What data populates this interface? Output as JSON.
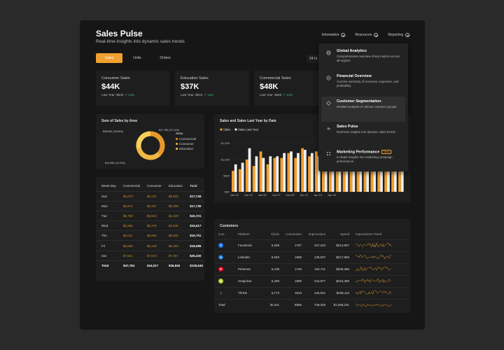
{
  "header": {
    "title": "Sales Pulse",
    "subtitle": "Real-time insights into dynamic sales trends"
  },
  "nav": {
    "items": [
      "Information",
      "Resources",
      "Reporting"
    ]
  },
  "tabs": {
    "items": [
      "Sales",
      "Units",
      "Orders"
    ],
    "active": "Sales"
  },
  "date_filter": "24 hr",
  "kpis": [
    {
      "label": "Consumer Sales",
      "value": "$44K",
      "last_year": "Last Year: $62K",
      "change": "↗ 14%"
    },
    {
      "label": "Education Sales",
      "value": "$37K",
      "last_year": "Last Year: $51K",
      "change": "↗ 14%"
    },
    {
      "label": "Commercial Sales",
      "value": "$48K",
      "last_year": "Last Year: $69K",
      "change": "↗ 14%"
    }
  ],
  "donut_card": {
    "title": "Sum of Sales by Area",
    "labels": [
      "$38.89K (28.84%)",
      "$47.78K (37.14%)",
      "$44.08K (34.22%)"
    ],
    "legend_title": "Area",
    "colors": [
      "#e8982a",
      "#f3b843",
      "#f7cf5a"
    ]
  },
  "weekly_table": {
    "headers": [
      "Week Day",
      "Commercial",
      "Consumer",
      "Education",
      "Total"
    ],
    "rows": [
      [
        "Sun",
        "$6,070",
        "$6,247",
        "$5,533",
        "$17,749"
      ],
      [
        "Mon",
        "$6,574",
        "$6,347",
        "$5,059",
        "$17,730"
      ],
      [
        "Tue",
        "$5,758",
        "$5,624",
        "$4,340",
        "$15,721"
      ],
      [
        "Wed",
        "$6,255",
        "$5,478",
        "$4,845",
        "$16,517"
      ],
      [
        "Thu",
        "$6,011",
        "$5,680",
        "$5,000",
        "$16,701"
      ],
      [
        "Fri",
        "$6,596",
        "$6,129",
        "$5,493",
        "$18,086"
      ],
      [
        "Sat",
        "$7,531",
        "$7,672",
        "$7,067",
        "$25,330"
      ]
    ],
    "total": [
      "Total",
      "$47,784",
      "$44,017",
      "$36,845",
      "$128,646"
    ]
  },
  "customers": {
    "title": "Customers",
    "headers": [
      "Icon",
      "Platform",
      "Clicks",
      "Conversion",
      "Impressions",
      "Spend",
      "Impressions Trend"
    ],
    "rows": [
      {
        "icon": "facebook-icon",
        "color": "#1877f2",
        "glyph": "f",
        "platform": "Facebook",
        "clicks": "6,269",
        "conversion": "1787",
        "impressions": "167,223",
        "spend": "$214,807"
      },
      {
        "icon": "linkedin-icon",
        "color": "#0a66c2",
        "glyph": "in",
        "platform": "LinkedIn",
        "clicks": "5,563",
        "conversion": "1659",
        "impressions": "139,537",
        "spend": "$217,865"
      },
      {
        "icon": "pinterest-icon",
        "color": "#e60023",
        "glyph": "P",
        "platform": "Pinterest",
        "clicks": "6,238",
        "conversion": "1746",
        "impressions": "152,711",
        "spend": "$209,366"
      },
      {
        "icon": "snapchat-icon",
        "color": "#b8d62a",
        "glyph": "S",
        "platform": "Snapchat",
        "clicks": "6,258",
        "conversion": "1850",
        "impressions": "142,877",
        "spend": "$215,355"
      },
      {
        "icon": "tiktok-icon",
        "color": "#222222",
        "glyph": "♪",
        "platform": "TikTok",
        "clicks": "5,773",
        "conversion": "1813",
        "impressions": "146,941",
        "spend": "$208,112"
      }
    ],
    "total": {
      "label": "Total",
      "clicks": "30,411",
      "conversion": "8855",
      "impressions": "749,029",
      "spend": "$1,058,201"
    }
  },
  "dropdown": {
    "items": [
      {
        "title": "Global Analytics",
        "desc": "Comprehensive overview of key metrics across all regions",
        "icon": "globe-icon"
      },
      {
        "title": "Financial Overview",
        "desc": "Concise summary of revenues, expenses, and profitability",
        "icon": "coin-icon"
      },
      {
        "title": "Customer Segmentation",
        "desc": "Detailed analysis of various customer groups",
        "icon": "diamond-icon"
      },
      {
        "title": "Sales Pulse",
        "desc": "Real-time insights into dynamic sales trends",
        "icon": "pulse-icon"
      },
      {
        "title": "Marketing Performance",
        "desc": "In-depth insights into marketing campaign performance",
        "icon": "nodes-icon",
        "badge": "New"
      }
    ],
    "selected": "Customer Segmentation"
  },
  "chart_data": [
    {
      "type": "pie",
      "title": "Sum of Sales by Area",
      "categories": [
        "Commercial",
        "Consumer",
        "Education"
      ],
      "values": [
        37.14,
        34.22,
        28.84
      ]
    },
    {
      "type": "bar",
      "title": "Sales and Sales Last Year by Date",
      "categories": [
        "Jan 01",
        "Jan 02",
        "Jan 03",
        "Jan 04",
        "Jan 05",
        "Jan 06",
        "Jan 07",
        "Jan 08",
        "Jan 09",
        "Jan 10",
        "Jan 11",
        "Jan 12",
        "Jan 13",
        "Jan 14",
        "Jan 15",
        "Jan 16",
        "Jan 17",
        "Jan 18",
        "Jan 19",
        "Jan 20",
        "Jan 21",
        "Jan 22",
        "Jan 23",
        "Jan 24",
        "Jan 25"
      ],
      "x_tick_labels": [
        "Jan 01",
        "Jan 03",
        "Jan 05",
        "Jan 07",
        "Jan 09",
        "Jan 11",
        "Jan 13",
        "Jan 15"
      ],
      "series": [
        {
          "name": "Sales",
          "color": "#f0a030",
          "values": [
            650,
            700,
            1000,
            800,
            1250,
            850,
            1050,
            1050,
            1200,
            1050,
            1350,
            1100,
            1250,
            1200,
            1100,
            1250,
            1050,
            1000,
            1050,
            1150,
            1100,
            1000,
            950,
            950,
            1000
          ]
        },
        {
          "name": "Sales Last Year",
          "color": "#efefef",
          "values": [
            850,
            900,
            1350,
            1100,
            1050,
            1100,
            1100,
            1200,
            1250,
            1200,
            1300,
            1200,
            1100,
            1450,
            1100,
            1000,
            1200,
            1100,
            1100,
            1350,
            1200,
            1100,
            1050,
            1150,
            1200
          ]
        }
      ],
      "yticks": [
        "$0K",
        "$500",
        "$1,000",
        "$1,500"
      ],
      "ylim": [
        0,
        1800
      ],
      "legend": "top-left"
    }
  ]
}
